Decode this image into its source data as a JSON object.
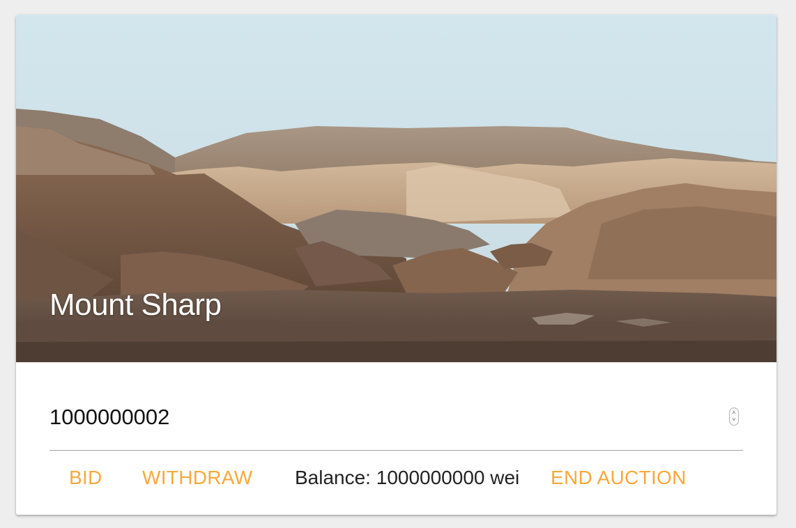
{
  "card": {
    "title": "Mount Sharp",
    "image_subject": "martian-landscape-photo"
  },
  "bid_input": {
    "value": "1000000002"
  },
  "actions": {
    "bid_label": "BID",
    "withdraw_label": "WITHDRAW",
    "balance_prefix": "Balance: ",
    "balance_value": "1000000000",
    "balance_unit": " wei",
    "end_auction_label": "END AUCTION"
  },
  "colors": {
    "accent": "#f9a83a",
    "sky": "#cfe2ea",
    "background": "#eeeeee"
  }
}
